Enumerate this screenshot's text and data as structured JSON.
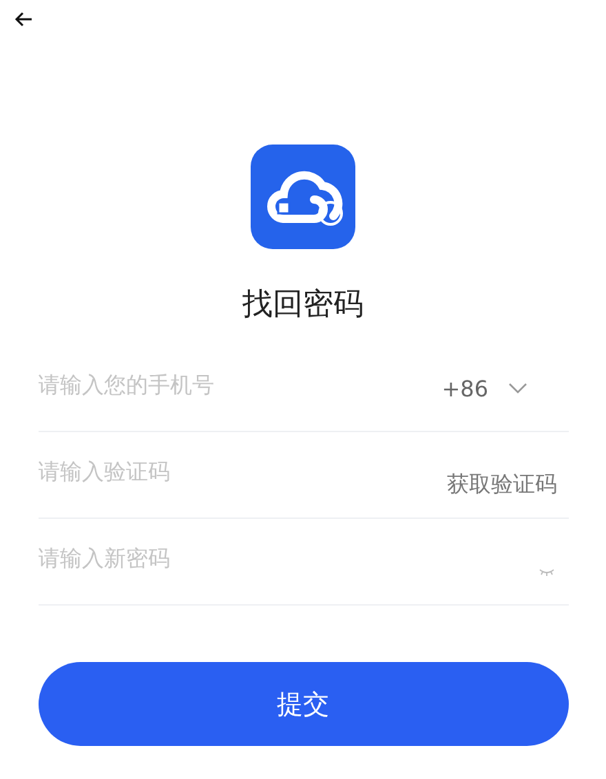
{
  "title": "找回密码",
  "fields": [
    {
      "kind": "phone",
      "placeholder": "请输入您的手机号",
      "addon": "+86"
    },
    {
      "kind": "code",
      "placeholder": "请输入验证码",
      "addon": "获取验证码"
    },
    {
      "kind": "password",
      "placeholder": "请输入新密码"
    }
  ],
  "submit": "提交"
}
